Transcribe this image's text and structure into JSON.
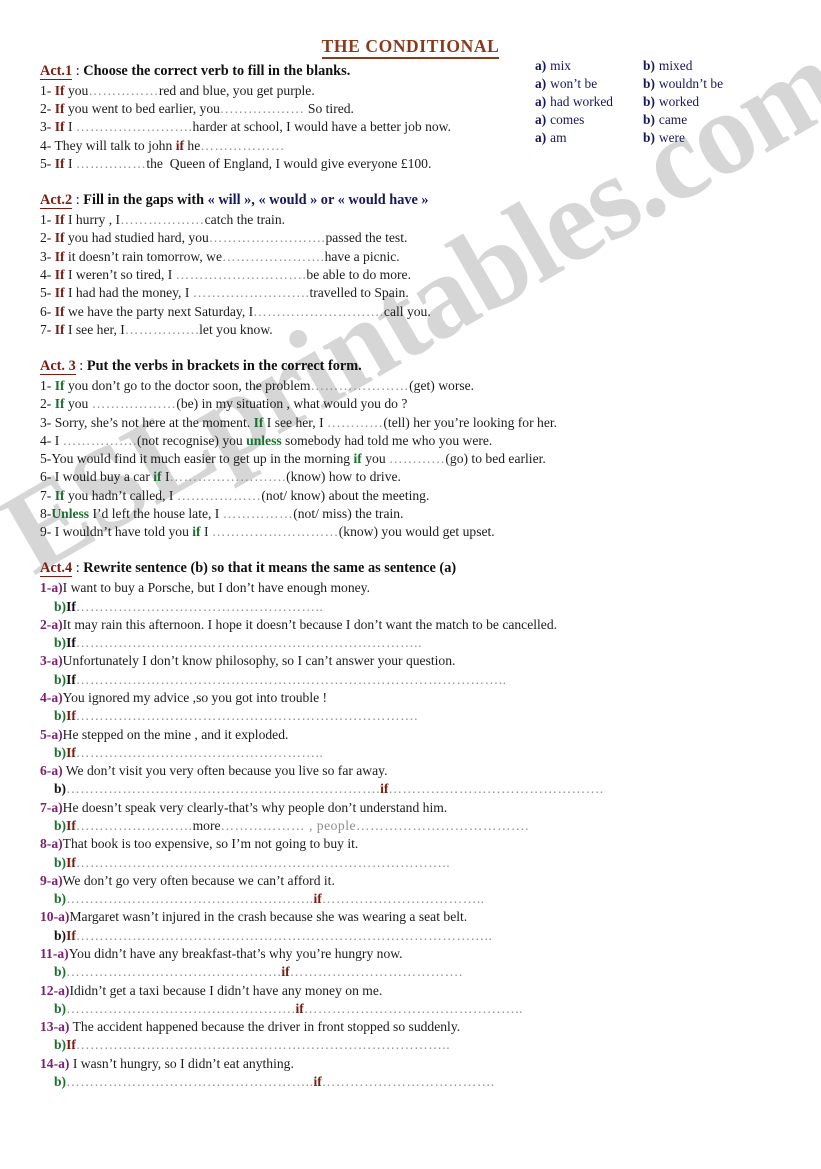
{
  "document": {
    "title": "THE  CONDITIONAL",
    "watermark": "ESLprintables.com",
    "colors": {
      "title": "#8a3a1c",
      "act_tag": "#7b1b12",
      "navy": "#16185e",
      "green": "#1b7031",
      "purple": "#7d1f6e",
      "body": "#1c1c1c"
    }
  },
  "act1": {
    "tag": "Act.1",
    "colon": " : ",
    "instruction": "Choose the correct verb to fill in the blanks.",
    "items": [
      {
        "num": "1- ",
        "kw": "If",
        "kw_color": "red",
        "pre": " you",
        "dots": "……………",
        "post": "red and blue, you get purple."
      },
      {
        "num": "2- ",
        "kw": "If",
        "kw_color": "red",
        "pre": " you went to bed earlier, you",
        "dots": "………………",
        "post": " So tired."
      },
      {
        "num": "3- ",
        "kw": "If",
        "kw_color": "red",
        "pre": " I ",
        "dots": "…………………….",
        "post": "harder at school, I would have a better job now."
      },
      {
        "num": "4- They will talk to john ",
        "kw": "if",
        "kw_color": "red",
        "pre": " he",
        "dots": "………………",
        "post": ""
      },
      {
        "num": "5- ",
        "kw": "If",
        "kw_color": "red",
        "pre": " I ",
        "dots": "……………",
        "post": "the  Queen of England, I would give everyone £100."
      }
    ],
    "options": [
      {
        "a_label": "a)",
        "a_text": "mix",
        "b_label": "b)",
        "b_text": "mixed"
      },
      {
        "a_label": "a)",
        "a_text": "won’t be",
        "b_label": "b)",
        "b_text": "wouldn’t be"
      },
      {
        "a_label": "a)",
        "a_text": "had worked",
        "b_label": "b)",
        "b_text": "worked"
      },
      {
        "a_label": "a)",
        "a_text": "comes",
        "b_label": "b)",
        "b_text": "came"
      },
      {
        "a_label": "a)",
        "a_text": "am",
        "b_label": "b)",
        "b_text": "were"
      }
    ]
  },
  "act2": {
    "tag": "Act.2",
    "colon": " : ",
    "instruction_plain": "Fill in the gaps with ",
    "instruction_navy": "« will », « would » or « would have »",
    "items": [
      {
        "num": "1- ",
        "kw": "If",
        "pre": " I hurry , I",
        "dots": "………………",
        "post": "catch the train."
      },
      {
        "num": "2- ",
        "kw": "If",
        "pre": " you had studied hard, you",
        "dots": "…………………….",
        "post": "passed the test."
      },
      {
        "num": "3- ",
        "kw": "If",
        "pre": " it doesn’t rain tomorrow, we",
        "dots": "………………….",
        "post": "have a picnic."
      },
      {
        "num": "4- ",
        "kw": "If",
        "pre": " I weren’t so tired, I ",
        "dots": "……………………….",
        "post": "be able to do more."
      },
      {
        "num": "5- ",
        "kw": "If",
        "pre": " I had had the money, I ",
        "dots": "…………………….",
        "post": "travelled to Spain."
      },
      {
        "num": "6- ",
        "kw": "If",
        "pre": " we have the party next Saturday, I",
        "dots": "……………………….",
        "post": "call you."
      },
      {
        "num": "7- ",
        "kw": "If",
        "pre": " I see her, I",
        "dots": "…………….",
        "post": "let you know."
      }
    ]
  },
  "act3": {
    "tag": "Act. 3",
    "colon": " : ",
    "instruction": "Put the verbs in brackets in the correct form.",
    "items": [
      {
        "segs": [
          {
            "t": "1- ",
            "s": "plain"
          },
          {
            "t": "If",
            "s": "green"
          },
          {
            "t": " you don’t go to the doctor soon, the problem",
            "s": "plain"
          },
          {
            "t": "…………………",
            "s": "dots"
          },
          {
            "t": "(get) worse.",
            "s": "plain"
          }
        ]
      },
      {
        "segs": [
          {
            "t": "2- ",
            "s": "plain"
          },
          {
            "t": "If",
            "s": "green"
          },
          {
            "t": " you ",
            "s": "plain"
          },
          {
            "t": "………………",
            "s": "dots"
          },
          {
            "t": "(be) in my situation , what would you do ?",
            "s": "plain"
          }
        ]
      },
      {
        "segs": [
          {
            "t": "3- Sorry, she’s not here at the moment. ",
            "s": "plain"
          },
          {
            "t": "If",
            "s": "green"
          },
          {
            "t": " I see her, I ",
            "s": "plain"
          },
          {
            "t": "…………",
            "s": "dots"
          },
          {
            "t": "(tell) her you’re looking for her.",
            "s": "plain"
          }
        ]
      },
      {
        "segs": [
          {
            "t": "4- I ",
            "s": "plain"
          },
          {
            "t": "…………….",
            "s": "dots"
          },
          {
            "t": "(not recognise) you ",
            "s": "plain"
          },
          {
            "t": "unless",
            "s": "green"
          },
          {
            "t": " somebody had told me who you were.",
            "s": "plain"
          }
        ]
      },
      {
        "segs": [
          {
            "t": "5-You would find it much easier to get up in the morning ",
            "s": "plain"
          },
          {
            "t": "if",
            "s": "green"
          },
          {
            "t": " you ",
            "s": "plain"
          },
          {
            "t": "…………",
            "s": "dots"
          },
          {
            "t": "(go) to bed earlier.",
            "s": "plain"
          }
        ]
      },
      {
        "segs": [
          {
            "t": "6- I would buy a car ",
            "s": "plain"
          },
          {
            "t": "if",
            "s": "green"
          },
          {
            "t": " I",
            "s": "plain"
          },
          {
            "t": "…………………….",
            "s": "dots"
          },
          {
            "t": "(know) how to drive.",
            "s": "plain"
          }
        ]
      },
      {
        "segs": [
          {
            "t": "7- ",
            "s": "plain"
          },
          {
            "t": "If",
            "s": "green"
          },
          {
            "t": " you hadn’t called, I ",
            "s": "plain"
          },
          {
            "t": "………………",
            "s": "dots"
          },
          {
            "t": "(not/ know) about the meeting.",
            "s": "plain"
          }
        ]
      },
      {
        "segs": [
          {
            "t": "8-",
            "s": "plain"
          },
          {
            "t": "Unless",
            "s": "green"
          },
          {
            "t": " I’d left the house late, I ",
            "s": "plain"
          },
          {
            "t": "……………",
            "s": "dots"
          },
          {
            "t": "(not/ miss) the train.",
            "s": "plain"
          }
        ]
      },
      {
        "segs": [
          {
            "t": "9- I wouldn’t have told you ",
            "s": "plain"
          },
          {
            "t": "if",
            "s": "green"
          },
          {
            "t": " I ",
            "s": "plain"
          },
          {
            "t": "………………………",
            "s": "dots"
          },
          {
            "t": "(know) you would get upset.",
            "s": "plain"
          }
        ]
      }
    ]
  },
  "act4": {
    "tag": "Act.4",
    "colon": " : ",
    "instruction": "Rewrite sentence (b) so that it means the same as sentence (a)",
    "items": [
      {
        "num": "1-a)",
        "a_text": "I want to buy a Porsche, but I don’t have enough money.",
        "b_label": "b)",
        "b_label_color": "green",
        "b_kw": "If",
        "b_kw_color": "black",
        "b_dots1": "……………………………………………..",
        "b_mid": "",
        "b_dots2": ""
      },
      {
        "num": "2-a)",
        "a_text": "It may rain this afternoon. I hope it doesn’t because I don’t want the match to be cancelled.",
        "b_label": "b)",
        "b_label_color": "green",
        "b_kw": "If",
        "b_kw_color": "black",
        "b_dots1": "………………………………………………………………..",
        "b_mid": "",
        "b_dots2": ""
      },
      {
        "num": "3-a)",
        "a_text": "Unfortunately I don’t know philosophy, so I can’t answer your question.",
        "b_label": "b)",
        "b_label_color": "green",
        "b_kw": "If",
        "b_kw_color": "black",
        "b_dots1": "………………………………………………………………………………..",
        "b_mid": "",
        "b_dots2": ""
      },
      {
        "num": "4-a)",
        "a_text": "You ignored my advice ,so you got into trouble !",
        "b_label": "b)",
        "b_label_color": "green",
        "b_kw": "If",
        "b_kw_color": "red",
        "b_dots1": "……………………………………………………………….",
        "b_mid": "",
        "b_dots2": ""
      },
      {
        "num": "5-a)",
        "a_text": "He stepped on the mine , and it exploded.",
        "b_label": "b)",
        "b_label_color": "green",
        "b_kw": "If",
        "b_kw_color": "red",
        "b_dots1": "……………………………………………..",
        "b_mid": "",
        "b_dots2": ""
      },
      {
        "num": "6-a)",
        "a_text": " We don’t visit you very often because you live so far away.",
        "b_label": "b)",
        "b_label_color": "black",
        "b_kw": "",
        "b_kw_color": "red",
        "b_dots1": "………………………………………………………….",
        "b_mid": "if",
        "b_dots2": "………………………………………."
      },
      {
        "num": "7-a)",
        "a_text": "He doesn’t speak very clearly-that’s why people don’t understand him.",
        "b_label": "b)",
        "b_label_color": "green",
        "b_kw": "If",
        "b_kw_color": "red",
        "b_dots1": "…………………….",
        "b_mid": "more",
        "b_dots2": "……………… , people………………………………."
      },
      {
        "num": "8-a)",
        "a_text": "That book is too expensive, so I’m not going to buy it.",
        "b_label": "b)",
        "b_label_color": "green",
        "b_kw": "If",
        "b_kw_color": "red",
        "b_dots1": "……………………………………………………………………..",
        "b_mid": "",
        "b_dots2": ""
      },
      {
        "num": "9-a)",
        "a_text": "We don’t go very often because we can’t afford it.",
        "b_label": "b)",
        "b_label_color": "green",
        "b_kw": "",
        "b_kw_color": "red",
        "b_dots1": "……………………………………………..",
        "b_mid": "if",
        "b_dots2": "…………………………….."
      },
      {
        "num": "10-a)",
        "a_text": "Margaret wasn’t injured in the crash because she was wearing a seat belt.",
        "b_label": "b)",
        "b_label_color": "black",
        "b_kw": "If",
        "b_kw_color": "red",
        "b_dots1": "……………………………………………………………………………..",
        "b_mid": "",
        "b_dots2": ""
      },
      {
        "num": "11-a)",
        "a_text": "You didn’t have any breakfast-that’s why you’re hungry now.",
        "b_label": "b)",
        "b_label_color": "green",
        "b_kw": "",
        "b_kw_color": "red",
        "b_dots1": "……………………………………….",
        "b_mid": "if",
        "b_dots2": "………………………………."
      },
      {
        "num": "12-a)",
        "a_text": "Ididn’t get a taxi because I didn’t have any money on me.",
        "b_label": "b)",
        "b_label_color": "green",
        "b_kw": "",
        "b_kw_color": "red",
        "b_dots1": "………………………………………….",
        "b_mid": "if",
        "b_dots2": "……………………………………….."
      },
      {
        "num": "13-a)",
        "a_text": " The accident happened because the driver in front stopped so suddenly.",
        "b_label": "b)",
        "b_label_color": "green",
        "b_kw": "If",
        "b_kw_color": "red",
        "b_dots1": "……………………………………………………………………..",
        "b_mid": "",
        "b_dots2": ""
      },
      {
        "num": "14-a)",
        "a_text": " I wasn’t hungry, so I didn’t eat anything.",
        "b_label": "b)",
        "b_label_color": "green",
        "b_kw": "",
        "b_kw_color": "red",
        "b_dots1": "……………………………………………..",
        "b_mid": "if",
        "b_dots2": "………………………………."
      }
    ]
  }
}
